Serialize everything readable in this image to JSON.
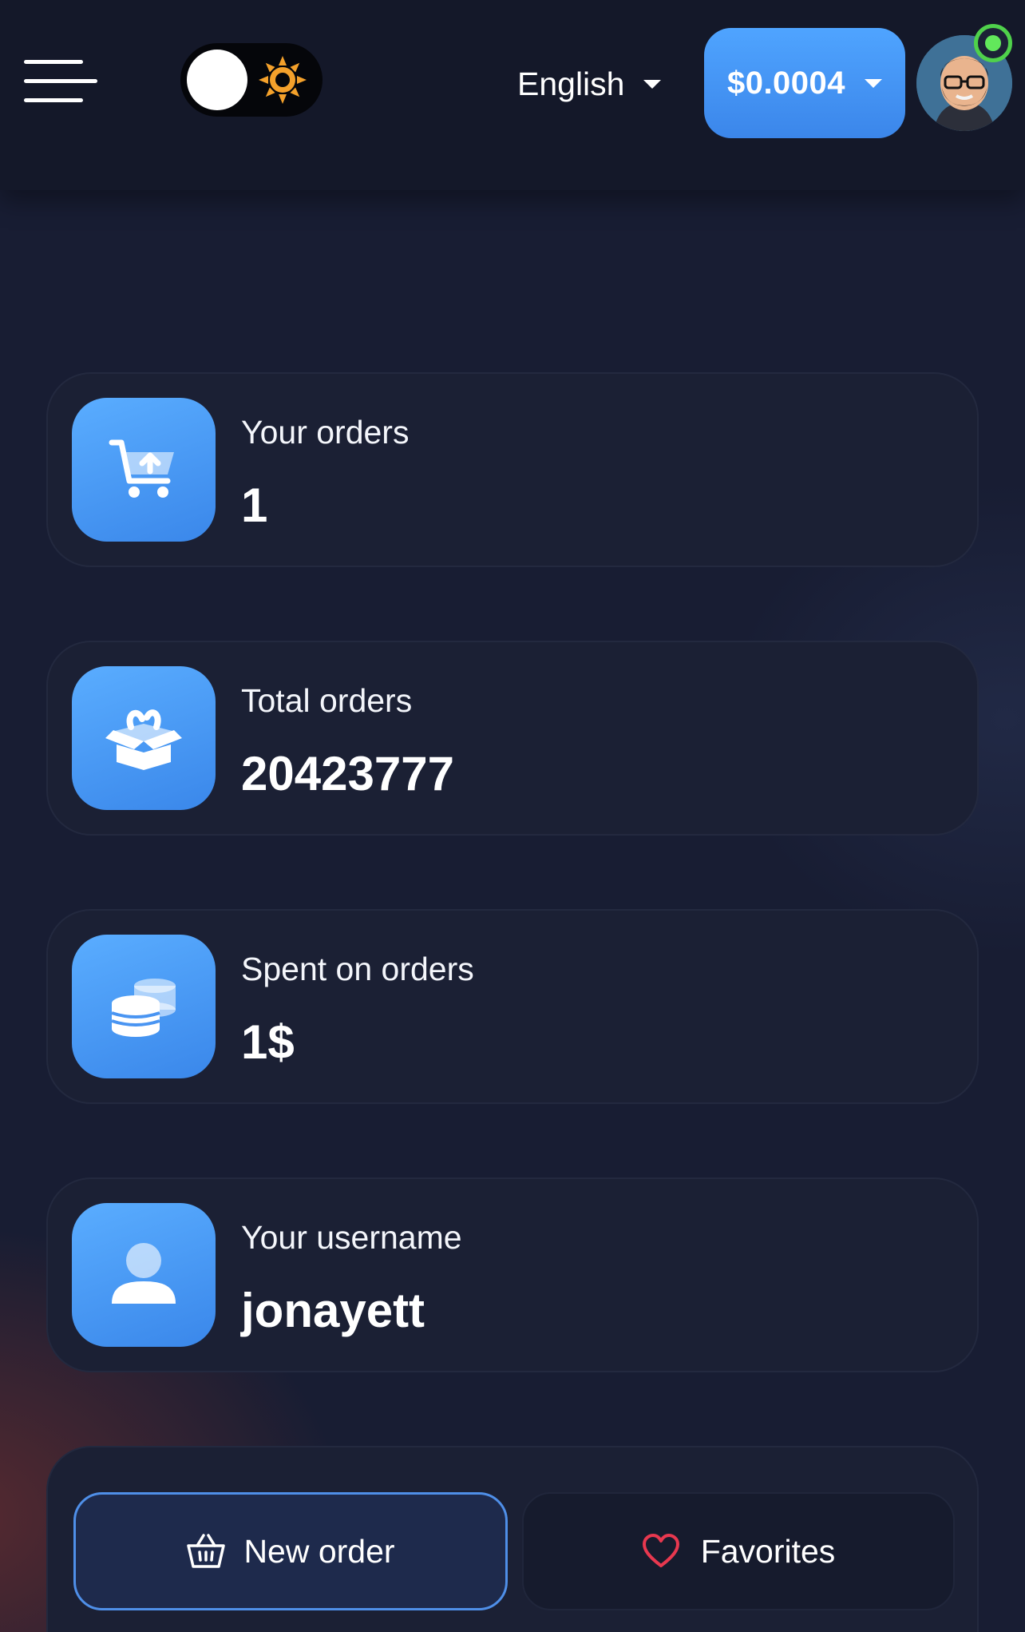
{
  "header": {
    "language": "English",
    "balance": "$0.0004",
    "theme_toggle_state": "dark",
    "avatar_status": "online"
  },
  "stats": [
    {
      "caption": "Your orders",
      "value": "1",
      "icon": "cart-upload-icon"
    },
    {
      "caption": "Total orders",
      "value": "20423777",
      "icon": "open-box-icon"
    },
    {
      "caption": "Spent on orders",
      "value": "1$",
      "icon": "coins-icon"
    },
    {
      "caption": "Your username",
      "value": "jonayett",
      "icon": "user-icon"
    }
  ],
  "actions": {
    "new_order": "New order",
    "favorites": "Favorites"
  },
  "colors": {
    "accent": "#4a9af5",
    "background": "#181d33",
    "card": "#1b2034",
    "online": "#62e85b",
    "heart": "#e8384f",
    "sun": "#f4a12b"
  }
}
